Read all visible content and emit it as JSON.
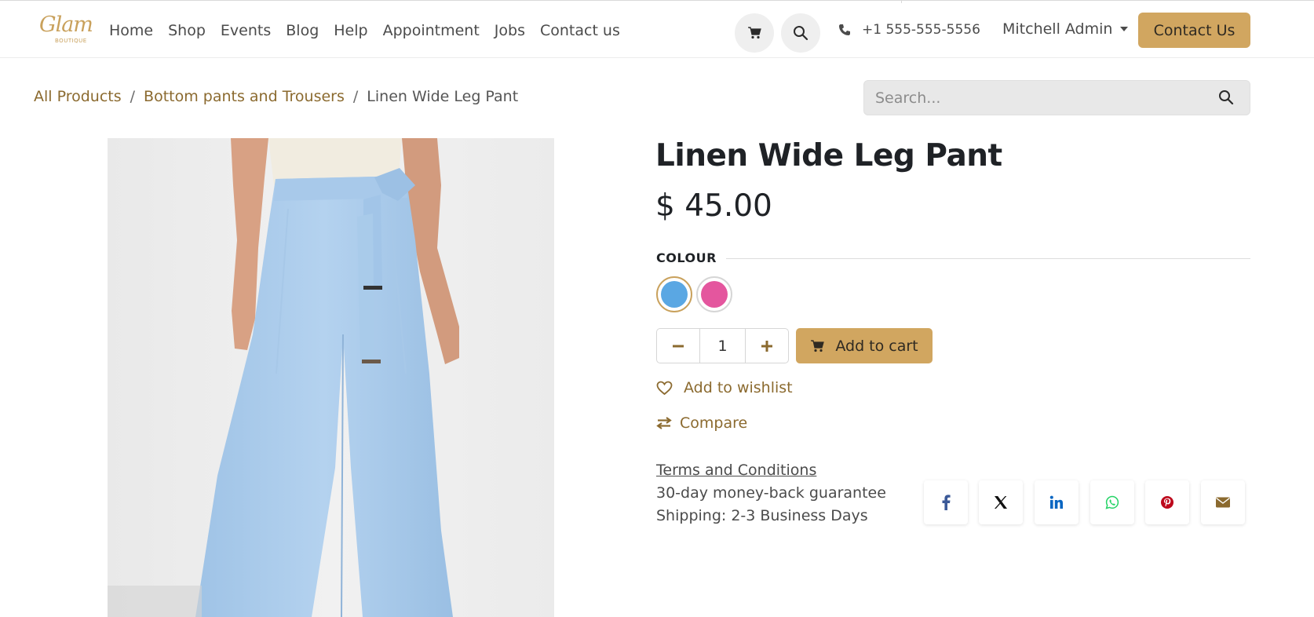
{
  "header": {
    "logo_text": "Glam",
    "logo_sub": "BOUTIQUE",
    "nav": [
      "Home",
      "Shop",
      "Events",
      "Blog",
      "Help",
      "Appointment",
      "Jobs",
      "Contact us"
    ],
    "phone": "+1 555-555-5556",
    "user": "Mitchell Admin",
    "contact_button": "Contact Us"
  },
  "breadcrumb": {
    "items": [
      "All Products",
      "Bottom pants and Trousers"
    ],
    "current": "Linen Wide Leg Pant",
    "separator": "/"
  },
  "search": {
    "placeholder": "Search..."
  },
  "product": {
    "name": "Linen Wide Leg Pant",
    "price": "$ 45.00",
    "attribute_label": "COLOUR",
    "colors": [
      {
        "name": "Blue",
        "hex": "#5aa7e3",
        "selected": true
      },
      {
        "name": "Pink",
        "hex": "#e4569e",
        "selected": false
      }
    ],
    "quantity": "1",
    "add_to_cart": "Add to cart",
    "wishlist": "Add to wishlist",
    "compare": "Compare",
    "terms": "Terms and Conditions",
    "guarantee": "30-day money-back guarantee",
    "shipping": "Shipping: 2-3 Business Days"
  },
  "share": [
    {
      "name": "facebook-icon",
      "color": "#3b5998"
    },
    {
      "name": "x-icon",
      "color": "#111111"
    },
    {
      "name": "linkedin-icon",
      "color": "#0a66c2"
    },
    {
      "name": "whatsapp-icon",
      "color": "#25d366"
    },
    {
      "name": "pinterest-icon",
      "color": "#bd081c"
    },
    {
      "name": "email-icon",
      "color": "#8b6a2f"
    }
  ],
  "colors": {
    "accent": "#d1a660",
    "link": "#8b6a2f",
    "text_dark": "#1f2226"
  }
}
